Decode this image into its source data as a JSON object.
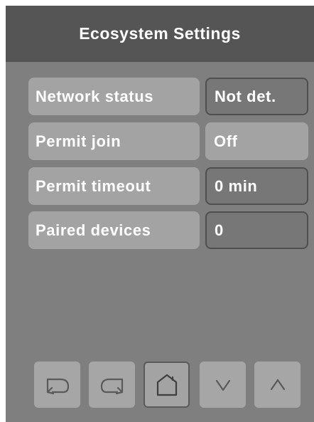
{
  "header": {
    "title": "Ecosystem Settings"
  },
  "rows": [
    {
      "label": "Network status",
      "value": "Not det."
    },
    {
      "label": "Permit join",
      "value": "Off"
    },
    {
      "label": "Permit timeout",
      "value": "0 min"
    },
    {
      "label": "Paired devices",
      "value": "0"
    }
  ],
  "nav": [
    {
      "icon": "undo-icon"
    },
    {
      "icon": "redo-icon"
    },
    {
      "icon": "home-icon"
    },
    {
      "icon": "chevron-down-icon"
    },
    {
      "icon": "chevron-up-icon"
    }
  ],
  "colors": {
    "panel": "#7f7f7f",
    "header": "#555555",
    "button": "#a3a3a3",
    "value_box": "#777777",
    "outline": "#4f4f4f",
    "text": "#ffffff"
  }
}
